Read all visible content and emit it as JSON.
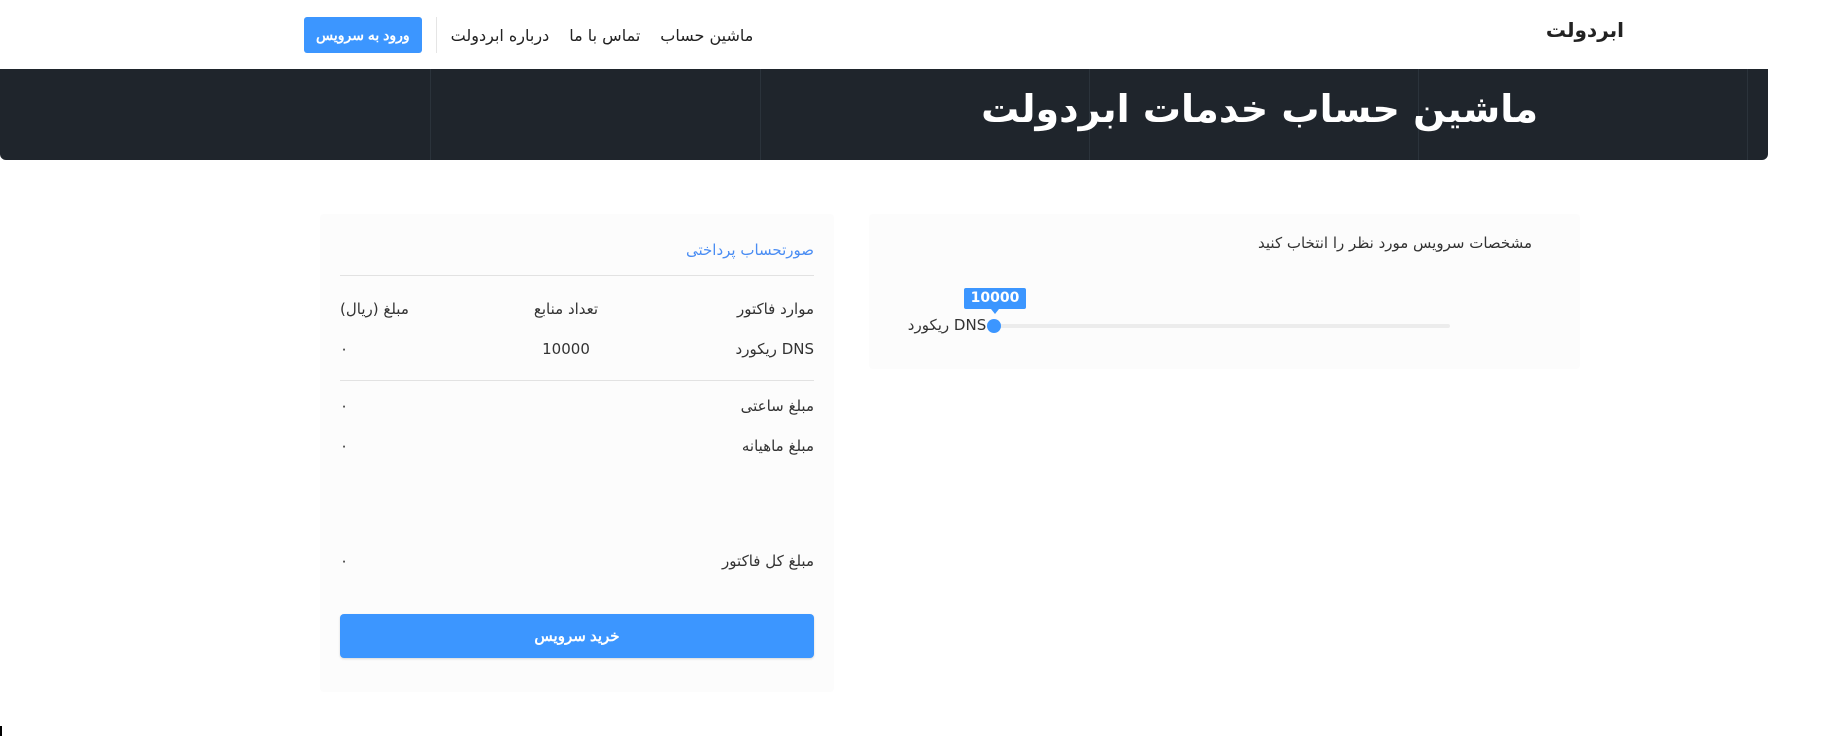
{
  "nav": {
    "brand": "ابردولت",
    "cta_label": "ورود به سرویس",
    "links": [
      {
        "label": "درباره ابردولت"
      },
      {
        "label": "تماس با ما"
      },
      {
        "label": "ماشین حساب"
      }
    ]
  },
  "hero": {
    "title": "ماشین حساب خدمات ابردولت"
  },
  "specs": {
    "heading": "مشخصات سرویس مورد نظر را انتخاب کنید",
    "slider": {
      "label": "DNS ریکورد",
      "value": "10000",
      "fraction": 0.0
    }
  },
  "invoice": {
    "title": "صورتحساب پرداختی",
    "headers": {
      "item": "موارد فاکتور",
      "count": "تعداد منابع",
      "amount": "مبلغ (ریال)"
    },
    "rows": [
      {
        "item": "DNS ریکورد",
        "count": "10000",
        "amount": "۰"
      }
    ],
    "hourly_label": "مبلغ ساعتی",
    "hourly_value": "۰",
    "monthly_label": "مبلغ ماهیانه",
    "monthly_value": "۰",
    "total_label": "مبلغ کل فاکتور",
    "total_value": "۰",
    "buy_label": "خرید سرویس"
  },
  "colors": {
    "accent": "#3c96ff",
    "hero_bg": "#1f252c",
    "invoice_title": "#4a8df3"
  }
}
